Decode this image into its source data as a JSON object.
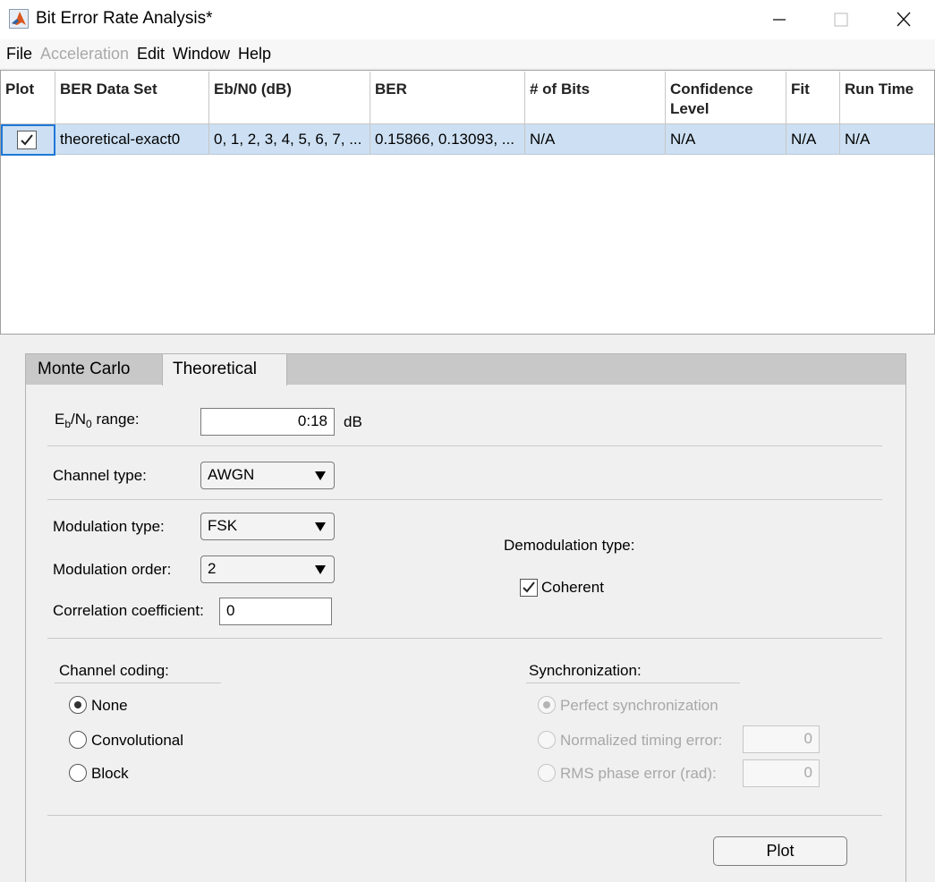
{
  "window": {
    "title": "Bit Error Rate Analysis*",
    "icon": "matlab-icon"
  },
  "menu": [
    "File",
    "Acceleration",
    "Edit",
    "Window",
    "Help"
  ],
  "menu_disabled": [
    "Acceleration"
  ],
  "table": {
    "headers": [
      "Plot",
      "BER Data Set",
      "Eb/N0 (dB)",
      "BER",
      "# of Bits",
      "Confidence\nLevel",
      "Fit",
      "Run Time"
    ],
    "rows": [
      {
        "plot_checked": true,
        "cells": [
          "theoretical-exact0",
          "0, 1, 2, 3, 4, 5, 6, 7, ...",
          "0.15866, 0.13093, ...",
          "N/A",
          "N/A",
          "N/A",
          "N/A"
        ]
      }
    ],
    "selected_row_color": "#cde0f3"
  },
  "tabs": [
    {
      "label": "Monte Carlo",
      "active": false
    },
    {
      "label": "Theoretical",
      "active": true
    }
  ],
  "theoretical": {
    "ebn0_label_prefix": "E",
    "ebn0_label_sub1": "b",
    "ebn0_label_mid": "/N",
    "ebn0_label_sub2": "0",
    "ebn0_label_suffix": " range:",
    "ebn0_value": "0:18",
    "ebn0_unit": "dB",
    "channel_type_label": "Channel type:",
    "channel_type_value": "AWGN",
    "modulation_type_label": "Modulation type:",
    "modulation_type_value": "FSK",
    "modulation_order_label": "Modulation order:",
    "modulation_order_value": "2",
    "correlation_label": "Correlation coefficient:",
    "correlation_value": "0",
    "demod_label": "Demodulation type:",
    "coherent_label": "Coherent",
    "coherent_checked": true,
    "channel_coding": {
      "title": "Channel coding:",
      "options": [
        "None",
        "Convolutional",
        "Block"
      ],
      "selected": "None"
    },
    "synchronization": {
      "title": "Synchronization:",
      "perfect_label": "Perfect synchronization",
      "timing_label": "Normalized timing error:",
      "timing_value": "0",
      "phase_label": "RMS phase error (rad):",
      "phase_value": "0",
      "selected": "Perfect synchronization",
      "enabled": false
    },
    "plot_button": "Plot"
  },
  "colors": {
    "focus": "#1e78d7",
    "background": "#f0f0f0",
    "disabled_text": "#a8a8a8"
  }
}
